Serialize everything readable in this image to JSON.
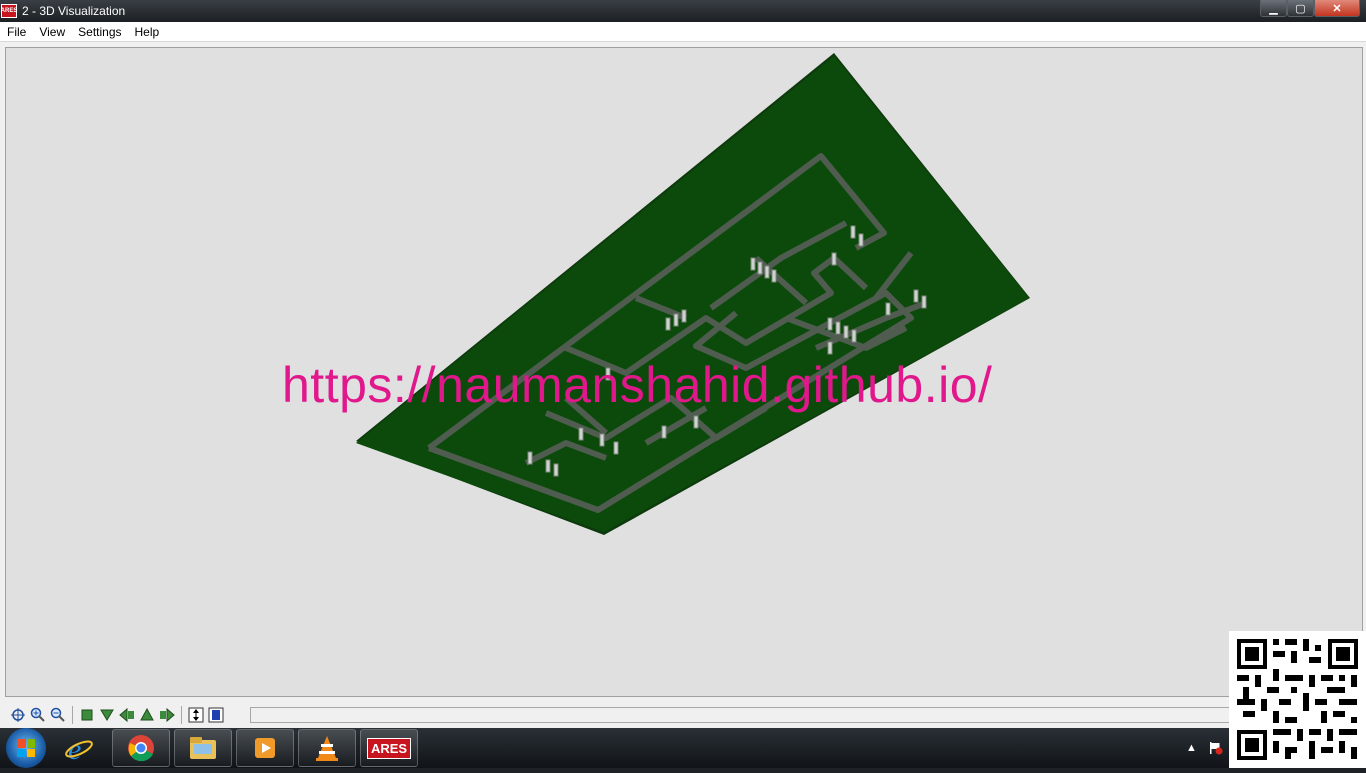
{
  "window": {
    "app_icon_text": "ARES",
    "title": "2 - 3D Visualization",
    "minimize_label": "▁",
    "maximize_label": "▢",
    "close_label": "✕"
  },
  "menu": [
    "File",
    "View",
    "Settings",
    "Help"
  ],
  "watermark": "https://naumanshahid.github.io/",
  "toolbar": {
    "icons": [
      "crosshair-icon",
      "zoom-in-icon",
      "zoom-out-icon",
      "top-view-icon",
      "front-view-icon",
      "left-view-icon",
      "rear-view-icon",
      "right-view-icon",
      "height-icon",
      "components-icon"
    ]
  },
  "taskbar": {
    "items": [
      "internet-explorer-icon",
      "chrome-icon",
      "file-explorer-icon",
      "media-player-icon",
      "vlc-icon",
      "ares-icon"
    ],
    "ares_label": "ARES",
    "tray_arrow": "▲"
  },
  "colors": {
    "board": "#0a4a0a",
    "trace": "#4d5a4d",
    "watermark": "#e0188c"
  }
}
